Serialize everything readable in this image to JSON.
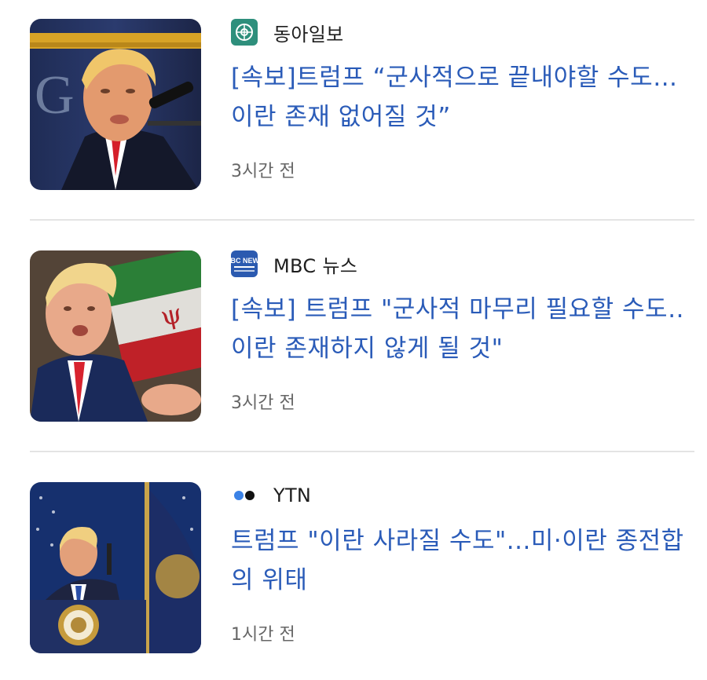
{
  "articles": [
    {
      "source": "동아일보",
      "source_icon": "donga-logo-icon",
      "headline": "[속보]트럼프 “군사적으로 끝내야할 수도…이란 존재 없어질 것”",
      "time": "3시간 전"
    },
    {
      "source": "MBC 뉴스",
      "source_icon": "mbc-news-logo-icon",
      "headline": "[속보] 트럼프 \"군사적 마무리 필요할 수도‥이란 존재하지 않게 될 것\"",
      "time": "3시간 전"
    },
    {
      "source": "YTN",
      "source_icon": "ytn-logo-icon",
      "headline": "트럼프 \"이란 사라질 수도\"...미·이란 종전합의 위태",
      "time": "1시간 전"
    }
  ],
  "logo_texts": {
    "mbc": "MBC NEWS"
  },
  "colors": {
    "headline": "#2a5bb8",
    "divider": "#e4e4e4",
    "time": "#666666"
  }
}
